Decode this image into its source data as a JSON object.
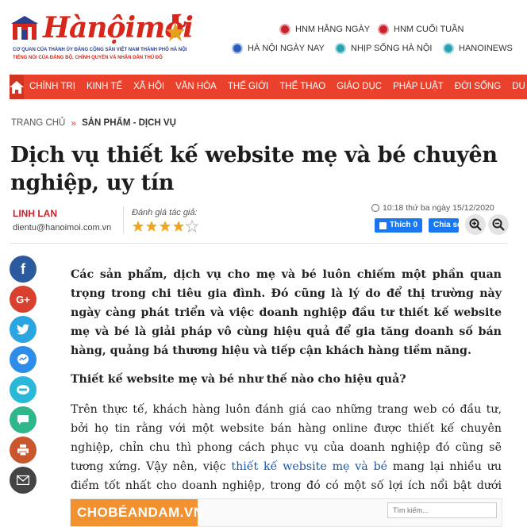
{
  "header": {
    "logo_title": "Hànộimới",
    "logo_subtitle_1": "CƠ QUAN CỦA THÀNH ỦY ĐẢNG CỘNG SẢN VIỆT NAM THÀNH PHỐ HÀ NỘI",
    "logo_subtitle_2": "TIẾNG NÓI CỦA ĐẢNG BỘ, CHÍNH QUYỀN VÀ NHÂN DÂN THỦ ĐÔ",
    "links": {
      "hnm_daily": "HNM HẰNG NGÀY",
      "hnm_weekend": "HNM CUỐI TUẦN",
      "hanoi_today": "HÀ NỘI NGÀY NAY",
      "hanoi_life": "NHỊP SỐNG HÀ NỘI",
      "hanoinews": "HANOINEWS"
    }
  },
  "nav": {
    "items": [
      "CHÍNH TRỊ",
      "KINH TẾ",
      "XÃ HỘI",
      "VĂN HÓA",
      "THẾ GIỚI",
      "THỂ THAO",
      "GIÁO DỤC",
      "PHÁP LUẬT",
      "ĐỜI SỐNG",
      "DU L"
    ]
  },
  "breadcrumb": {
    "home": "TRANG CHỦ",
    "separator": "»",
    "current": "SẢN PHẨM - DỊCH VỤ"
  },
  "article": {
    "title": "Dịch vụ thiết kế website mẹ và bé chuyên nghiệp, uy tín",
    "author": "LINH LAN",
    "email": "dientu@hanoimoi.com.vn",
    "rating_label": "Đánh giá tác giả:",
    "rating": 4,
    "rating_max": 5,
    "timestamp": "10:18 thứ ba ngày 15/12/2020",
    "like_label": "Thích 0",
    "share_label": "Chia sẻ",
    "lead": "Các sản phẩm, dịch vụ cho mẹ và bé luôn chiếm một phần quan trọng trong chi tiêu gia đình. Đó cũng là lý do để thị trường này ngày càng phát triển và việc doanh nghiệp đầu tư thiết kế website mẹ và bé là giải pháp vô cùng hiệu quả để gia tăng doanh số bán hàng, quảng bá thương hiệu và tiếp cận khách hàng tiềm năng.",
    "subheading": "Thiết kế website mẹ và bé như thế nào cho hiệu quả?",
    "para_before_link": "Trên thực tế, khách hàng luôn đánh giá cao những trang web có đầu tư, bởi họ tin rằng với một website bán hàng online được thiết kế chuyên nghiệp, chỉn chu thì phong cách phục vụ của doanh nghiệp đó cũng sẽ tương xứng. Vậy nên, việc ",
    "link_text": "thiết kế website mẹ và bé",
    "para_after_link": " mang lại nhiều ưu điểm tốt nhất cho doanh nghiệp, trong đó có một số lợi ích nổi bật dưới đây."
  },
  "embed": {
    "logo": "CHOBÉANDAM.VN",
    "search_placeholder": "Tìm kiếm..."
  },
  "colors": {
    "brand_red": "#e9412b",
    "author_red": "#c8232b",
    "facebook_blue": "#1877f2",
    "link_blue": "#1a56a8"
  },
  "social_icons": [
    "facebook-icon",
    "google-plus-icon",
    "twitter-icon",
    "messenger-icon",
    "zalo-icon",
    "comment-icon",
    "print-icon",
    "email-icon"
  ]
}
